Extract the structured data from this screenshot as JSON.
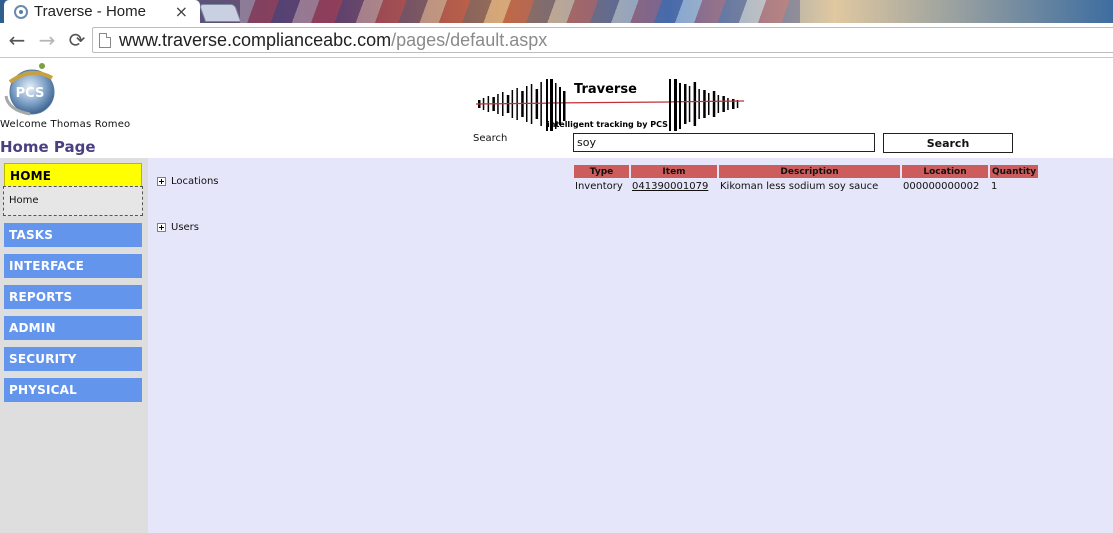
{
  "browser": {
    "tab_title": "Traverse - Home",
    "tab_close": "×",
    "url_host": "www.traverse.complianceabc.com",
    "url_path": "/pages/default.aspx",
    "back_glyph": "←",
    "forward_glyph": "→",
    "reload_glyph": "⟳"
  },
  "header": {
    "logo_text": "PCS",
    "welcome": "Welcome Thomas Romeo",
    "page_title": "Home Page",
    "brand_name": "Traverse",
    "brand_tagline": "intelligent tracking by PCS"
  },
  "search": {
    "label": "Search",
    "value": "soy",
    "button_label": "Search"
  },
  "sidebar": {
    "items": [
      {
        "label": "HOME"
      },
      {
        "label": "TASKS"
      },
      {
        "label": "INTERFACE"
      },
      {
        "label": "REPORTS"
      },
      {
        "label": "ADMIN"
      },
      {
        "label": "SECURITY"
      },
      {
        "label": "PHYSICAL"
      }
    ],
    "home_submenu": "Home"
  },
  "tree": {
    "locations": "Locations",
    "users": "Users"
  },
  "results": {
    "headers": [
      "Type",
      "Item",
      "Description",
      "Location",
      "Quantity"
    ],
    "rows": [
      {
        "type": "Inventory",
        "item": "041390001079",
        "description": "Kikoman less sodium soy sauce",
        "location": "000000000002",
        "quantity": "1"
      }
    ]
  },
  "colors": {
    "menu_blue": "#6495ed",
    "menu_active": "#ffff00",
    "content_bg": "#e6e6fa",
    "table_header": "#cd5c5c",
    "title_purple": "#4a3f80"
  }
}
